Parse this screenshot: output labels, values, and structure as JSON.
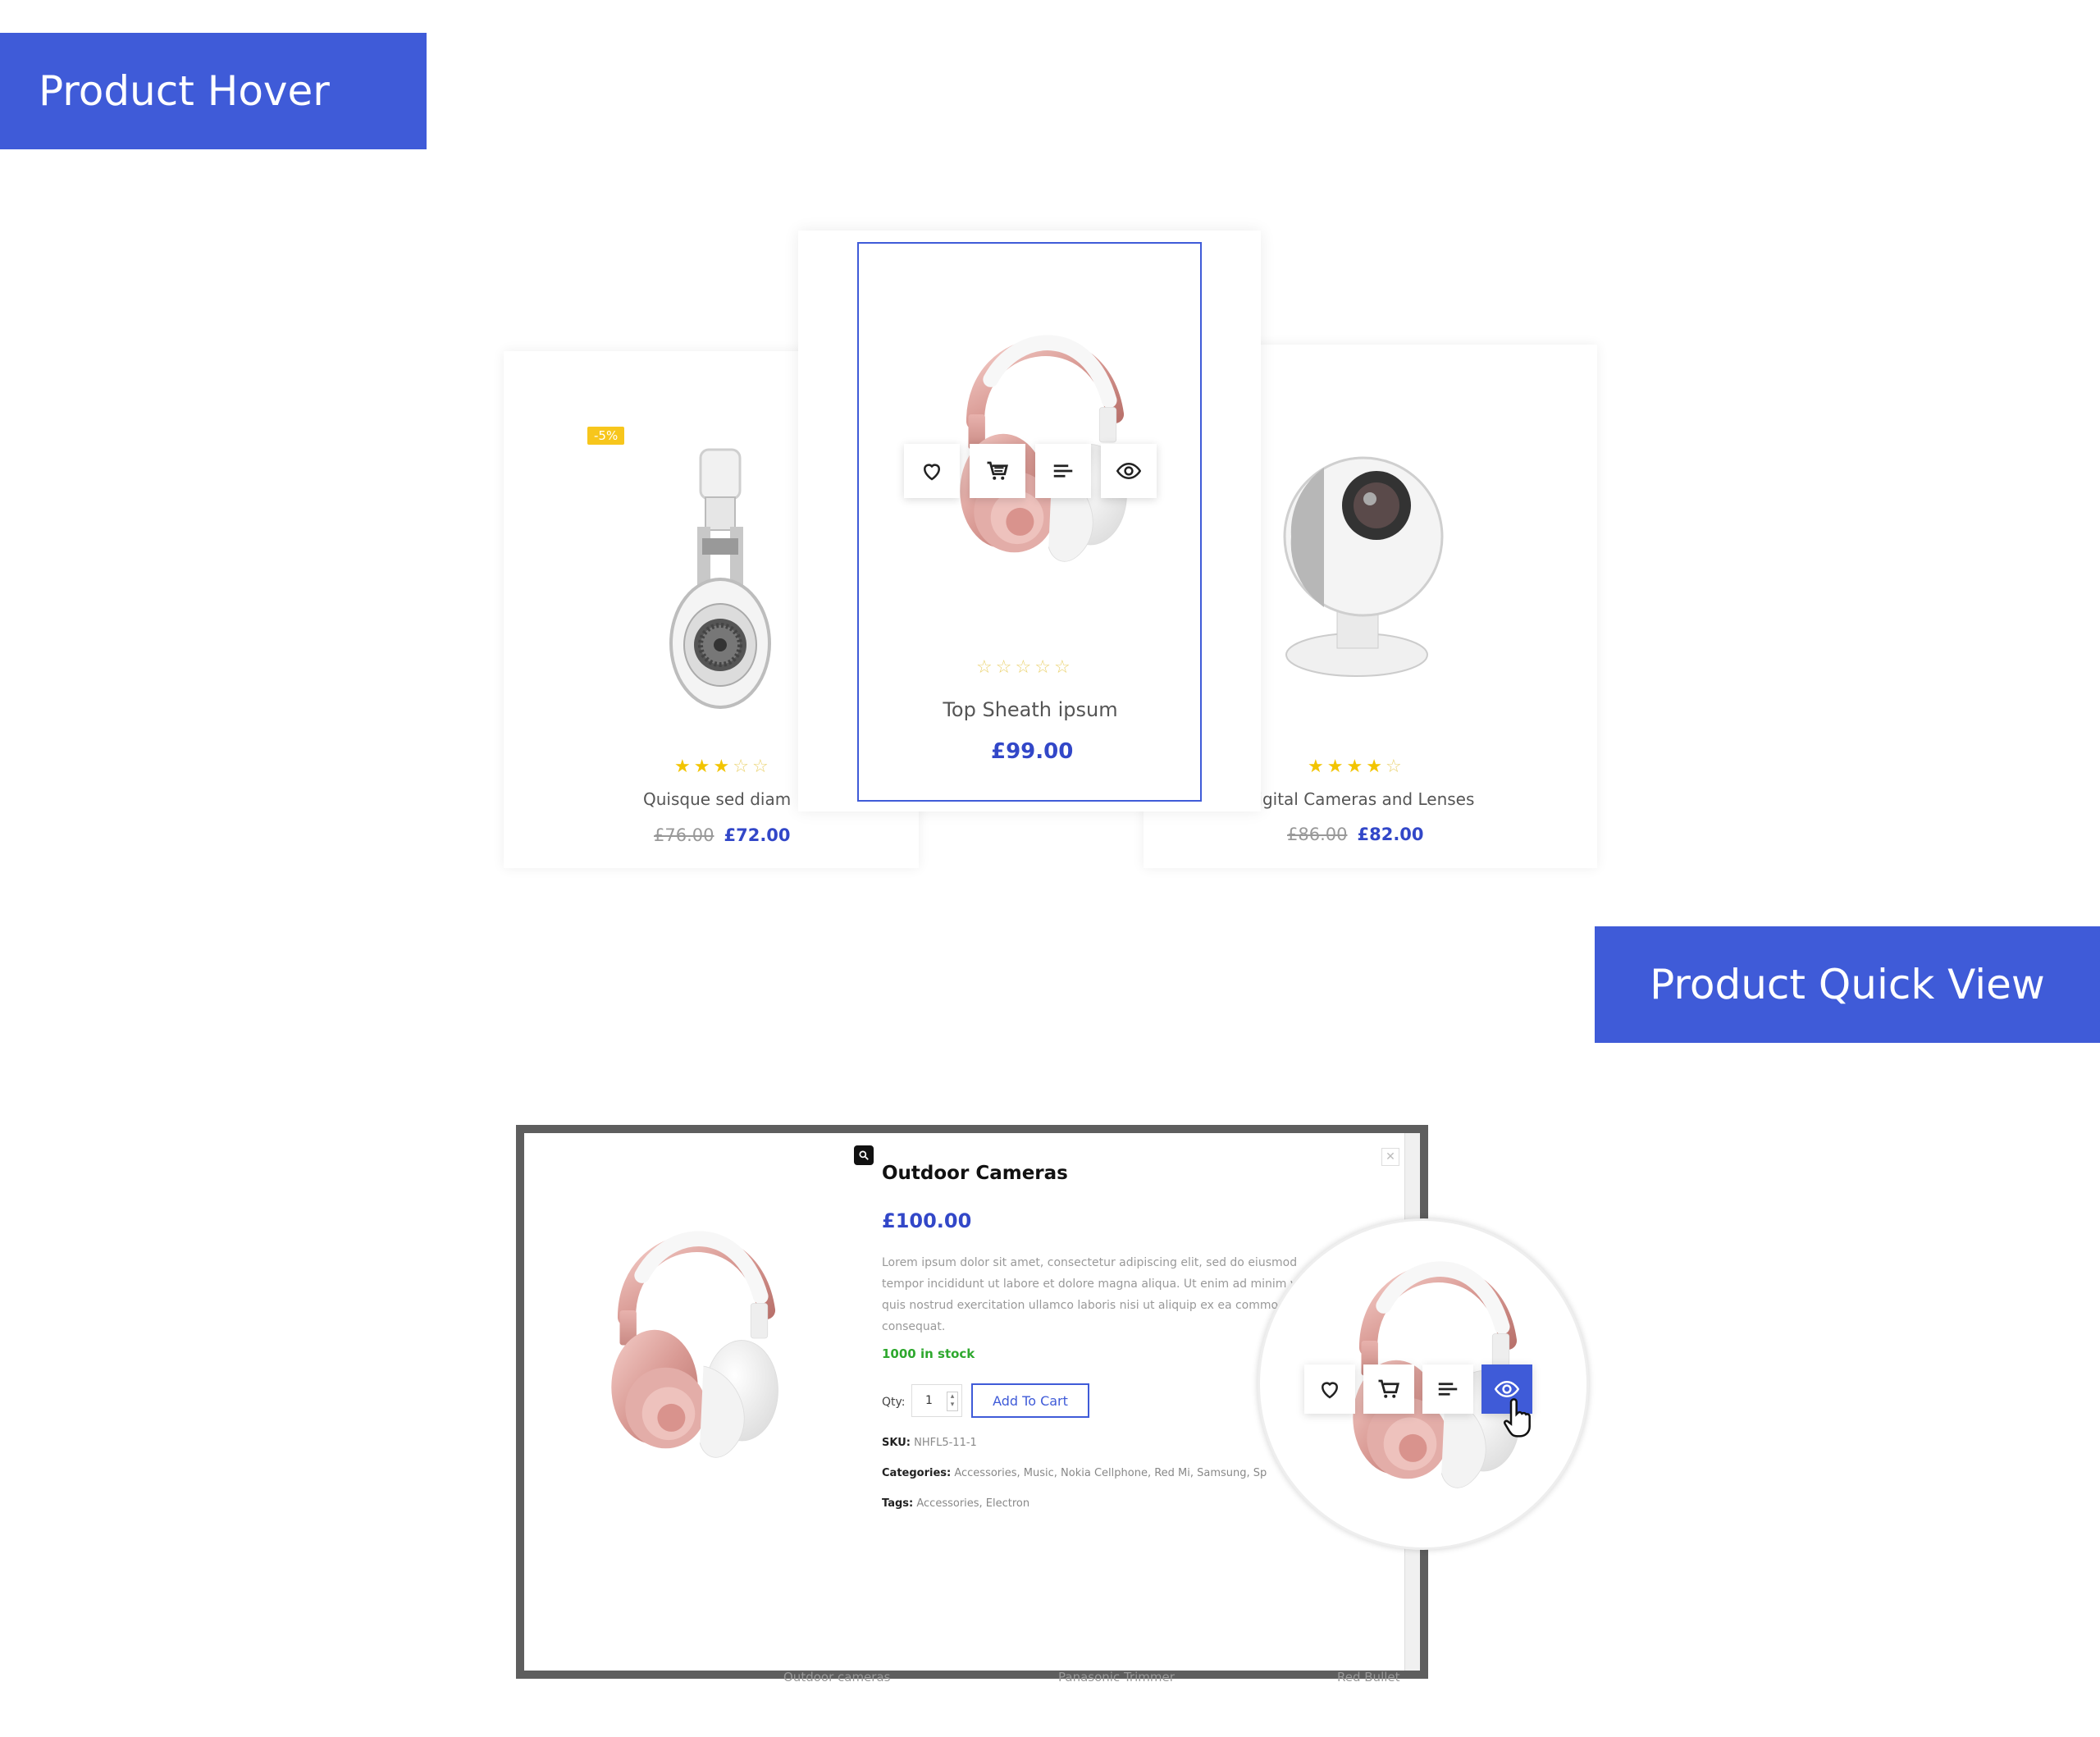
{
  "banners": {
    "hover": "Product Hover",
    "quick_view": "Product Quick View"
  },
  "products": [
    {
      "name": "Quisque sed diam",
      "old_price": "£76.00",
      "price": "£72.00",
      "badge": "-5%",
      "rating": 3
    },
    {
      "name": "Top Sheath ipsum",
      "price": "£99.00",
      "rating": 0
    },
    {
      "name": "Digital Cameras and Lenses",
      "old_price": "£86.00",
      "price": "£82.00",
      "rating": 4.5
    }
  ],
  "hover_actions": [
    "heart-icon",
    "cart-icon",
    "compare-icon",
    "eye-icon"
  ],
  "quick_view": {
    "title": "Outdoor Cameras",
    "price": "£100.00",
    "description": "Lorem ipsum dolor sit amet, consectetur adipiscing elit, sed do eiusmod tempor incididunt ut labore et dolore magna aliqua. Ut enim ad minim veniam, quis nostrud exercitation ullamco laboris nisi ut aliquip ex ea commodo consequat.",
    "stock": "1000 in stock",
    "qty_label": "Qty:",
    "qty_value": "1",
    "add_to_cart": "Add To Cart",
    "sku_label": "SKU:",
    "sku": "NHFL5-11-1",
    "categories_label": "Categories:",
    "categories": "Accessories, Music, Nokia Cellphone, Red Mi, Samsung, Sp",
    "tags_label": "Tags:",
    "tags": "Accessories, Electron",
    "behind_labels": [
      "Outdoor cameras",
      "Panasonic Trimmer",
      "Red Bullet"
    ]
  },
  "colors": {
    "accent": "#3f5bd8",
    "price": "#3247c8",
    "star": "#f2c400",
    "stock": "#2ea82e",
    "badge": "#f7c61c"
  }
}
